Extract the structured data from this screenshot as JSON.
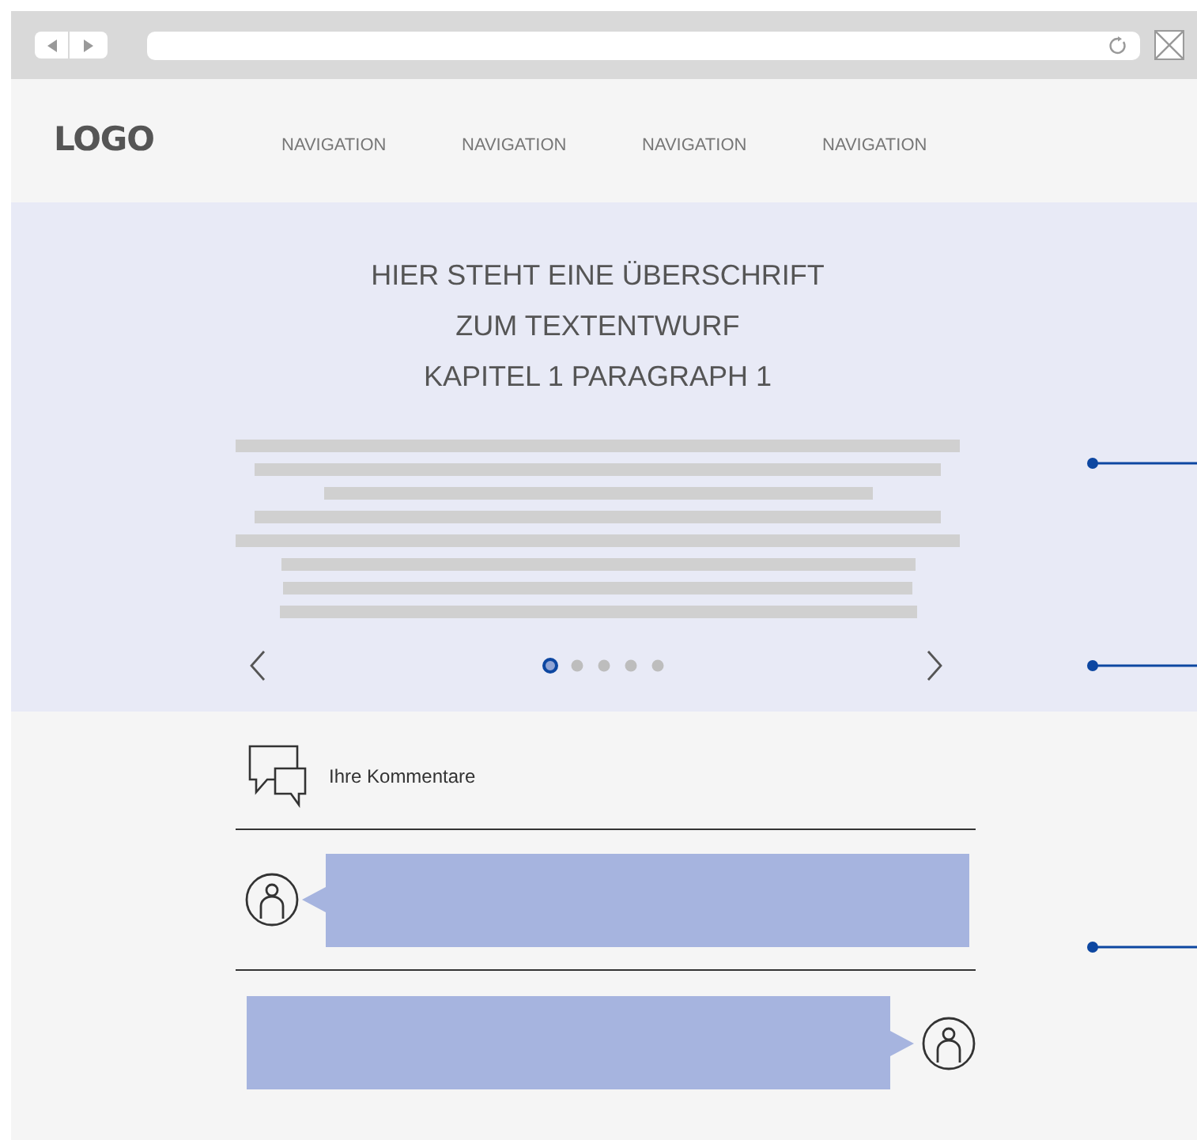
{
  "header": {
    "logo": "LOGO",
    "navigation": [
      "NAVIGATION",
      "NAVIGATION",
      "NAVIGATION",
      "NAVIGATION"
    ]
  },
  "hero": {
    "heading_lines": [
      "HIER STEHT EINE ÜBERSCHRIFT",
      "ZUM TEXTENTWURF",
      "KAPITEL 1 PARAGRAPH 1"
    ],
    "carousel_dots": [
      {
        "selected": true
      },
      {
        "selected": false
      },
      {
        "selected": false
      },
      {
        "selected": false
      },
      {
        "selected": false
      }
    ]
  },
  "comments": {
    "title": "Ihre Kommentare",
    "items": [
      {
        "kind": "left"
      },
      {
        "kind": "right"
      }
    ]
  }
}
